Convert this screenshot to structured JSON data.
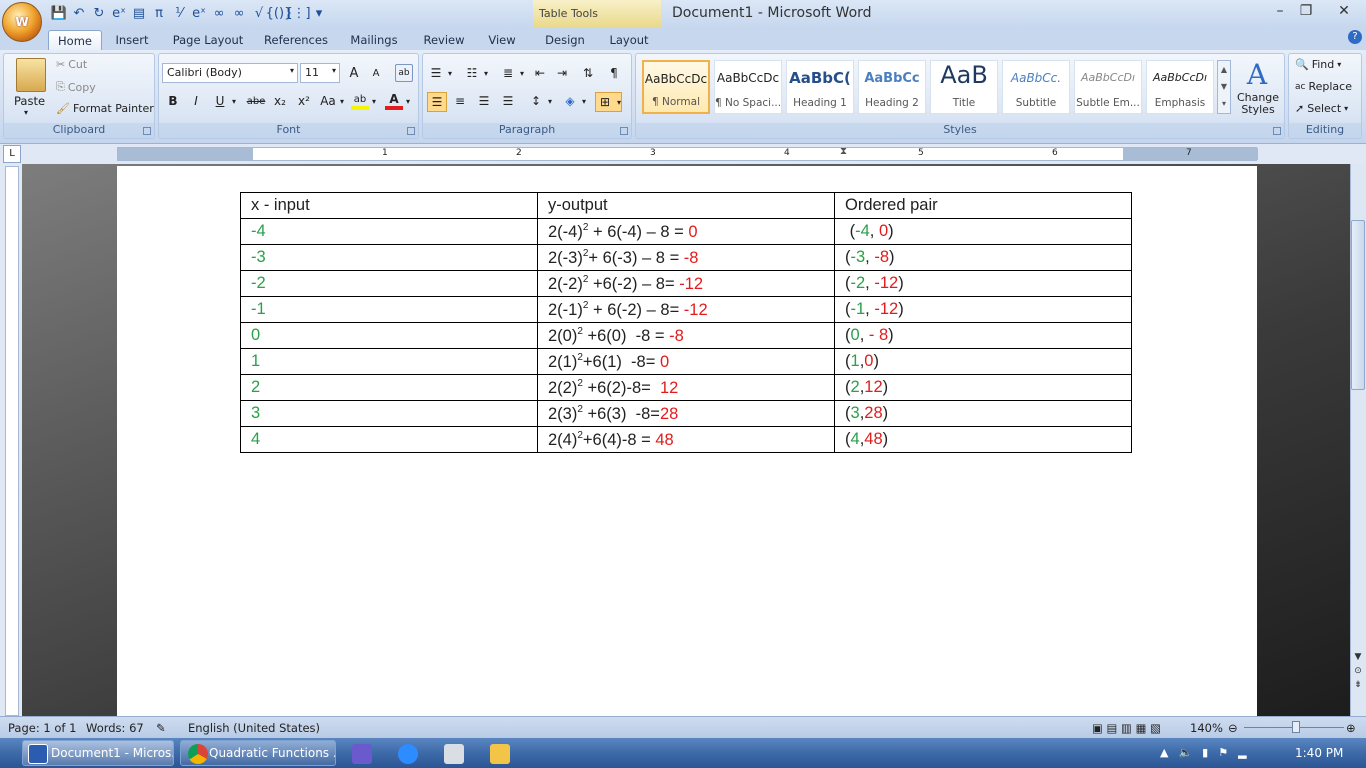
{
  "titlebar": {
    "office_button": "W",
    "table_tools": "Table Tools",
    "window_title": "Document1 - Microsoft Word",
    "minimize": "–",
    "maximize": "❐",
    "close": "✕"
  },
  "tabs": [
    "Home",
    "Insert",
    "Page Layout",
    "References",
    "Mailings",
    "Review",
    "View",
    "Design",
    "Layout"
  ],
  "ribbon": {
    "clipboard": {
      "label": "Clipboard",
      "paste": "Paste",
      "cut": "Cut",
      "copy": "Copy",
      "format_painter": "Format Painter"
    },
    "font": {
      "label": "Font",
      "font_name": "Calibri (Body)",
      "font_size": "11",
      "bold": "B",
      "italic": "I",
      "underline": "U",
      "strike": "abe",
      "subscript": "x₂",
      "superscript": "x²",
      "change_case": "Aa",
      "grow": "A",
      "shrink": "A"
    },
    "paragraph": {
      "label": "Paragraph"
    },
    "styles": {
      "label": "Styles",
      "items": [
        {
          "preview": "AaBbCcDc",
          "name": "¶ Normal"
        },
        {
          "preview": "AaBbCcDc",
          "name": "¶ No Spaci..."
        },
        {
          "preview": "AaBbC(",
          "name": "Heading 1"
        },
        {
          "preview": "AaBbCc",
          "name": "Heading 2"
        },
        {
          "preview": "AaB",
          "name": "Title"
        },
        {
          "preview": "AaBbCc.",
          "name": "Subtitle"
        },
        {
          "preview": "AaBbCcDı",
          "name": "Subtle Em..."
        },
        {
          "preview": "AaBbCcDı",
          "name": "Emphasis"
        }
      ],
      "change_styles": "Change Styles"
    },
    "editing": {
      "label": "Editing",
      "find": "Find",
      "replace": "Replace",
      "select": "Select"
    }
  },
  "ruler": {
    "corner": "L",
    "numbers": [
      "1",
      "2",
      "3",
      "4",
      "5",
      "6",
      "7"
    ]
  },
  "table": {
    "headers": [
      "x - input",
      "y-output",
      "Ordered pair"
    ],
    "rows": [
      {
        "x": "-4",
        "eq_a": "2(-4)",
        "eq_b": " + 6(-4) – 8 = ",
        "eq_val": "0",
        "p_pre": " (",
        "p_x": "-4",
        "p_sep": ", ",
        "p_y": "0",
        "p_end": ")"
      },
      {
        "x": "-3",
        "eq_a": "2(-3)",
        "eq_b": "+ 6(-3) – 8 = ",
        "eq_val": "-8",
        "p_pre": "(",
        "p_x": "-3",
        "p_sep": ", ",
        "p_y": "-8",
        "p_end": ")"
      },
      {
        "x": "-2",
        "eq_a": "2(-2)",
        "eq_b": " +6(-2) – 8= ",
        "eq_val": "-12",
        "p_pre": "(",
        "p_x": "-2",
        "p_sep": ", ",
        "p_y": "-12",
        "p_end": ")"
      },
      {
        "x": "-1",
        "eq_a": "2(-1)",
        "eq_b": " + 6(-2) – 8= ",
        "eq_val": "-12",
        "p_pre": "(",
        "p_x": "-1",
        "p_sep": ", ",
        "p_y": "-12",
        "p_end": ")"
      },
      {
        "x": "0",
        "eq_a": "2(0)",
        "eq_b": " +6(0)  -8 = ",
        "eq_val": "-8",
        "p_pre": "(",
        "p_x": "0",
        "p_sep": ", ",
        "p_y": "- 8",
        "p_end": ")"
      },
      {
        "x": "1",
        "eq_a": "2(1)",
        "eq_b": "+6(1)  -8= ",
        "eq_val": "0",
        "p_pre": "(",
        "p_x": "1",
        "p_sep": ",",
        "p_y": "0",
        "p_end": ")"
      },
      {
        "x": "2",
        "eq_a": "2(2)",
        "eq_b": " +6(2)-8=  ",
        "eq_val": "12",
        "p_pre": "(",
        "p_x": "2",
        "p_sep": ",",
        "p_y": "12",
        "p_end": ")"
      },
      {
        "x": "3",
        "eq_a": "2(3)",
        "eq_b": " +6(3)  -8=",
        "eq_val": "28",
        "p_pre": "(",
        "p_x": "3",
        "p_sep": ",",
        "p_y": "28",
        "p_end": ")"
      },
      {
        "x": "4",
        "eq_a": "2(4)",
        "eq_b": "+6(4)-8 = ",
        "eq_val": "48",
        "p_pre": "(",
        "p_x": "4",
        "p_sep": ",",
        "p_y": "48",
        "p_end": ")"
      }
    ]
  },
  "statusbar": {
    "page": "Page: 1 of 1",
    "words": "Words: 67",
    "language": "English (United States)",
    "zoom": "140%"
  },
  "taskbar": {
    "word_task": "Document1 - Micros...",
    "chrome_task": "Quadratic Functions ...",
    "time": "1:40 PM"
  },
  "colors": {
    "green": "#2aa04a",
    "red": "#e21c1c",
    "ribbon": "#d1def0"
  }
}
